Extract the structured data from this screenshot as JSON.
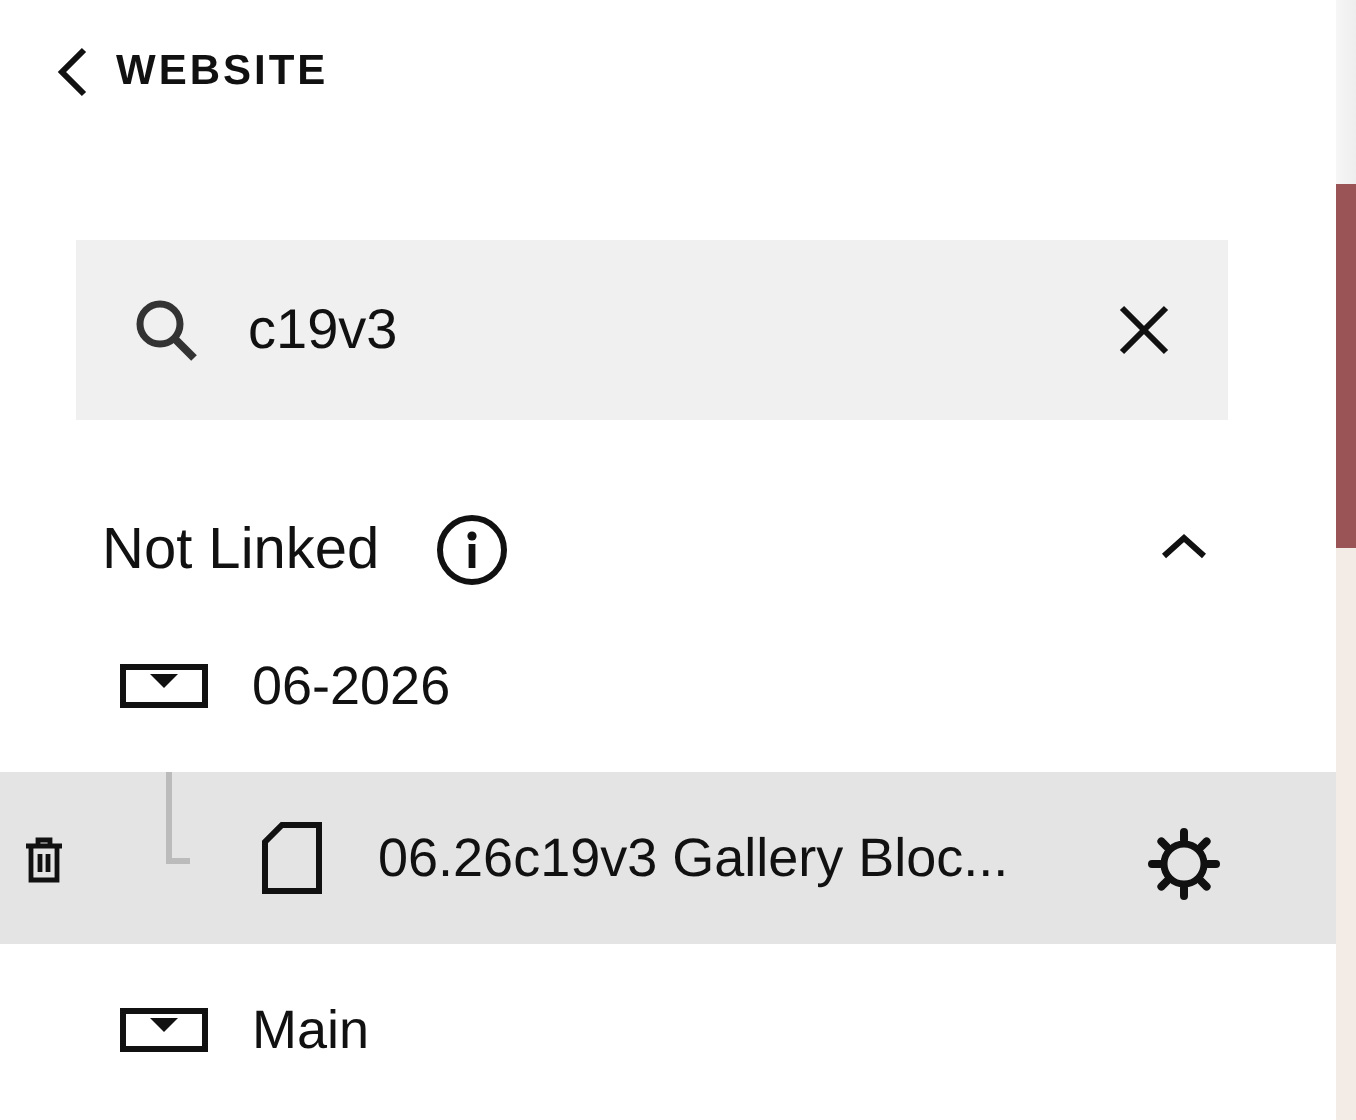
{
  "header": {
    "back_label": "WEBSITE"
  },
  "search": {
    "value": "c19v3"
  },
  "section": {
    "title": "Not Linked",
    "expanded": true,
    "items": [
      {
        "kind": "folder",
        "label": "06-2026",
        "selected": false,
        "children": [
          {
            "kind": "page",
            "label": "06.26c19v3 Gallery Bloc...",
            "selected": true
          }
        ]
      },
      {
        "kind": "folder",
        "label": "Main",
        "selected": false
      }
    ]
  }
}
